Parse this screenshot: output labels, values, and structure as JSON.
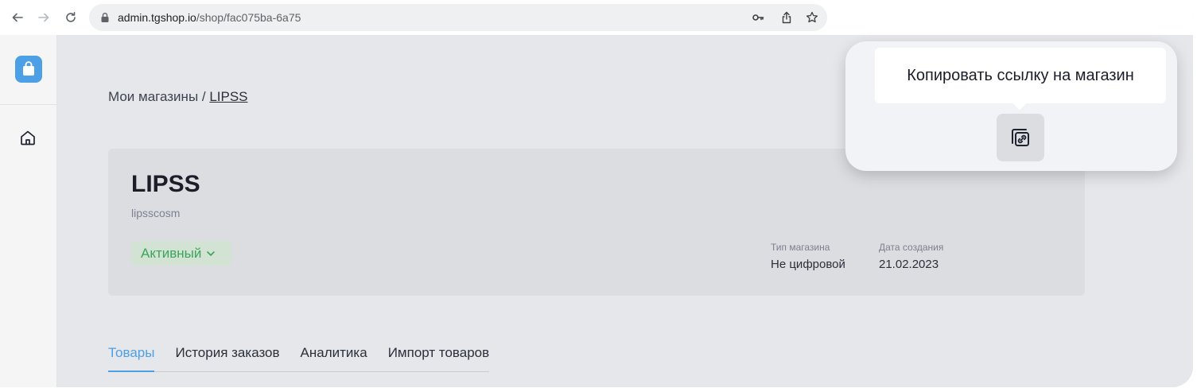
{
  "browser": {
    "url_host": "admin.tgshop.io",
    "url_path": "/shop/fac075ba-6a75"
  },
  "breadcrumb": {
    "root": "Мои магазины",
    "separator": " / ",
    "current": "LIPSS"
  },
  "shop": {
    "title": "LIPSS",
    "slug": "lipsscosm",
    "status": "Активный",
    "type_label": "Тип магазина",
    "type_value": "Не цифровой",
    "created_label": "Дата создания",
    "created_value": "21.02.2023"
  },
  "tabs": [
    {
      "label": "Товары",
      "active": true
    },
    {
      "label": "История заказов",
      "active": false
    },
    {
      "label": "Аналитика",
      "active": false
    },
    {
      "label": "Импорт товаров",
      "active": false
    }
  ],
  "popover": {
    "tooltip": "Копировать ссылку на магазин"
  },
  "colors": {
    "accent": "#4d9fe6",
    "status_green": "#3ba55c",
    "status_bg": "#d2e3d4"
  },
  "icons": {
    "back": "arrow-left-icon",
    "forward": "arrow-right-icon",
    "reload": "reload-icon",
    "lock": "lock-icon",
    "key": "key-icon",
    "share": "share-icon",
    "bookmark": "star-icon",
    "logo": "shopping-bag-icon",
    "home": "home-icon",
    "copy_link": "copy-link-icon"
  }
}
